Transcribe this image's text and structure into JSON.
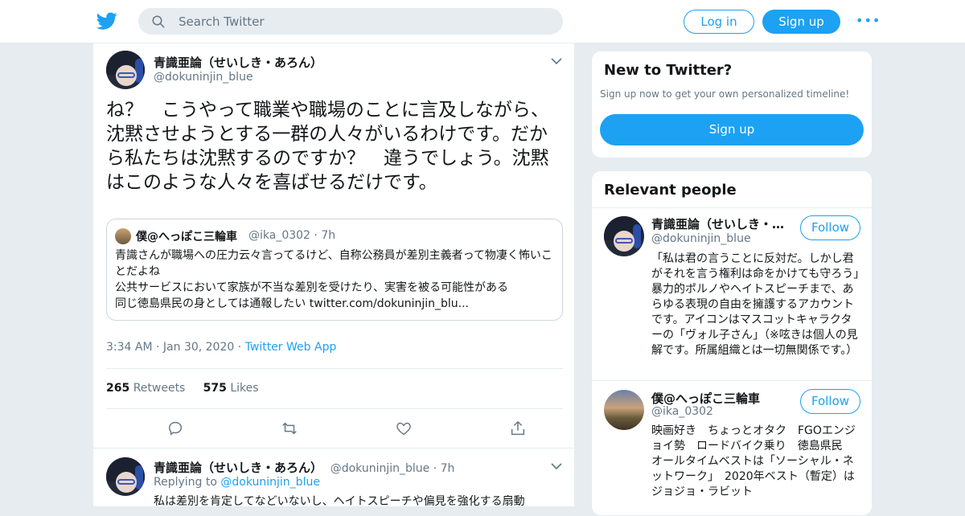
{
  "header": {
    "search_placeholder": "Search Twitter",
    "login_label": "Log in",
    "signup_label": "Sign up",
    "more_label": "•••"
  },
  "tweet": {
    "author_name": "青識亜論（せいしき・あろん）",
    "author_handle": "@dokuninjin_blue",
    "text": "ね？　こうやって職業や職場のことに言及しながら、沈黙させようとする一群の人々がいるわけです。だから私たちは沈黙するのですか？　違うでしょう。沈黙はこのような人々を喜ばせるだけです。",
    "quote": {
      "name": "僕@へっぽこ三輪車",
      "handle": "@ika_0302",
      "time": "7h",
      "line1": "青識さんが職場への圧力云々言ってるけど、自称公務員が差別主義者って物凄く怖いことだよね",
      "line2": "公共サービスにおいて家族が不当な差別を受けたり、実害を被る可能性がある",
      "line3": "同じ徳島県民の身としては通報したい twitter.com/dokuninjin_blu..."
    },
    "time": "3:34 AM",
    "date": "Jan 30, 2020",
    "source": "Twitter Web App",
    "retweets": "265",
    "retweets_label": "Retweets",
    "likes": "575",
    "likes_label": "Likes"
  },
  "reply": {
    "author_name": "青識亜論（せいしき・あろん）",
    "author_handle": "@dokuninjin_blue",
    "time": "7h",
    "replying_to_label": "Replying to",
    "replying_to": "@dokuninjin_blue",
    "text": "私は差別を肯定してなどいないし、ヘイトスピーチや偏見を強化する扇動"
  },
  "sidebar": {
    "new_title": "New to Twitter?",
    "new_sub": "Sign up now to get your own personalized timeline!",
    "new_button": "Sign up",
    "relevant_title": "Relevant people",
    "people": [
      {
        "name": "青識亜論（せいしき・あろん）",
        "handle": "@dokuninjin_blue",
        "follow": "Follow",
        "bio": "「私は君の言うことに反対だ。しかし君がそれを言う権利は命をかけても守ろう」暴力的ポルノやヘイトスピーチまで、あらゆる表現の自由を擁護するアカウントです。アイコンはマスコットキャラクターの「ヴォル子さん」（※呟きは個人の見解です。所属組織とは一切無関係です。）"
      },
      {
        "name": "僕@へっぽこ三輪車",
        "handle": "@ika_0302",
        "follow": "Follow",
        "bio": "映画好き　ちょっとオタク　FGOエンジョイ勢　ロードバイク乗り　徳島県民　　オールタイムベストは「ソーシャル・ネットワーク」　2020年ベスト（暫定）はジョジョ・ラビット"
      }
    ]
  },
  "colors": {
    "accent": "#1da1f2",
    "muted": "#657786",
    "background": "#e6ecf0"
  },
  "icons": [
    "twitter-bird-icon",
    "search-icon",
    "chevron-down-icon",
    "reply-icon",
    "retweet-icon",
    "like-icon",
    "share-icon"
  ]
}
